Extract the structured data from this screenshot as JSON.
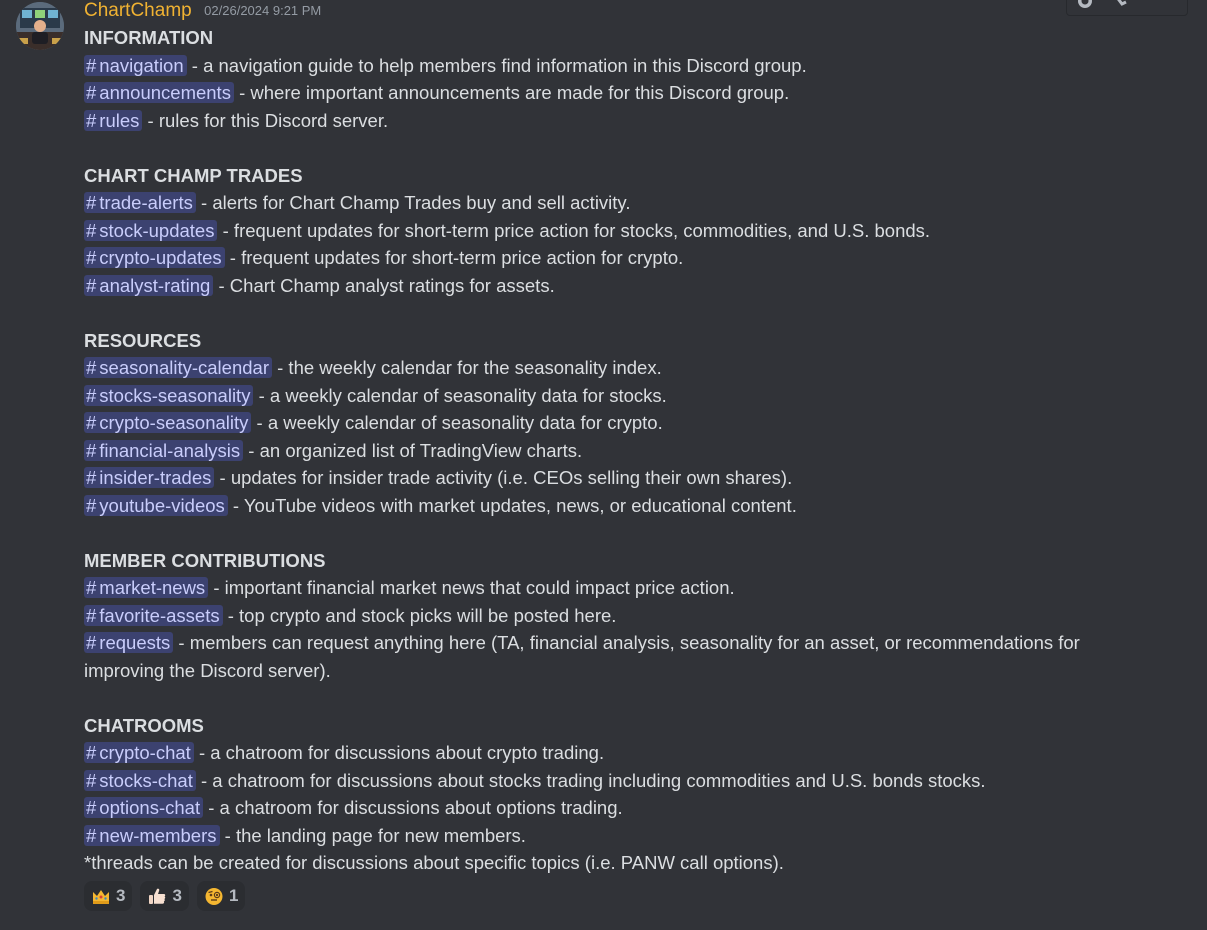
{
  "message": {
    "author": "ChartChamp",
    "timestamp": "02/26/2024 9:21 PM",
    "avatar_icon": "avatar-image"
  },
  "sections": [
    {
      "heading": "INFORMATION",
      "items": [
        {
          "channel": "navigation",
          "text": " - a navigation guide to help members find information in this Discord group."
        },
        {
          "channel": "announcements",
          "text": " - where important announcements are made for this Discord group."
        },
        {
          "channel": "rules",
          "text": " - rules for this Discord server."
        }
      ]
    },
    {
      "heading": "CHART CHAMP TRADES",
      "items": [
        {
          "channel": "trade-alerts",
          "text": " - alerts for Chart Champ Trades buy and sell activity."
        },
        {
          "channel": "stock-updates",
          "text": " - frequent updates for short-term price action for stocks, commodities, and U.S. bonds."
        },
        {
          "channel": "crypto-updates",
          "text": " - frequent updates for short-term price action for crypto."
        },
        {
          "channel": "analyst-rating",
          "text": " - Chart Champ analyst ratings for assets."
        }
      ]
    },
    {
      "heading": "RESOURCES",
      "items": [
        {
          "channel": "seasonality-calendar",
          "text": " - the weekly calendar for the seasonality index."
        },
        {
          "channel": "stocks-seasonality",
          "text": " - a weekly calendar of seasonality data for stocks."
        },
        {
          "channel": "crypto-seasonality",
          "text": " - a weekly calendar of seasonality data for crypto."
        },
        {
          "channel": "financial-analysis",
          "text": " - an organized list of TradingView charts."
        },
        {
          "channel": "insider-trades",
          "text": " - updates for insider trade activity (i.e. CEOs selling their own shares)."
        },
        {
          "channel": "youtube-videos",
          "text": " - YouTube videos with market updates, news, or educational content."
        }
      ]
    },
    {
      "heading": "MEMBER CONTRIBUTIONS",
      "items": [
        {
          "channel": "market-news",
          "text": " - important financial market news that could impact price action."
        },
        {
          "channel": "favorite-assets",
          "text": " - top crypto and stock picks will be posted here."
        },
        {
          "channel": "requests",
          "text": " - members can request anything here (TA, financial analysis, seasonality for an asset, or recommendations for improving the Discord server)."
        }
      ]
    },
    {
      "heading": "CHATROOMS",
      "items": [
        {
          "channel": "crypto-chat",
          "text": " - a chatroom for discussions about crypto trading."
        },
        {
          "channel": "stocks-chat",
          "text": " - a chatroom for discussions about stocks trading including commodities and U.S. bonds stocks."
        },
        {
          "channel": "options-chat",
          "text": " - a chatroom for discussions about options trading."
        },
        {
          "channel": "new-members",
          "text": " - the landing page for new members."
        }
      ]
    }
  ],
  "footnote": "*threads can be created for discussions about specific topics (i.e. PANW call options).",
  "channel_prefix": "#",
  "reactions": [
    {
      "emoji": "crown-emoji",
      "count": "3"
    },
    {
      "emoji": "thumbs-up-emoji",
      "count": "3"
    },
    {
      "emoji": "face-with-monocle-emoji",
      "count": "1"
    }
  ],
  "colors": {
    "background": "#313338",
    "username": "#f0b232",
    "mention_bg": "#3c4270",
    "mention_text": "#c9cdfb",
    "text": "#dbdee1",
    "timestamp": "#949ba4"
  }
}
